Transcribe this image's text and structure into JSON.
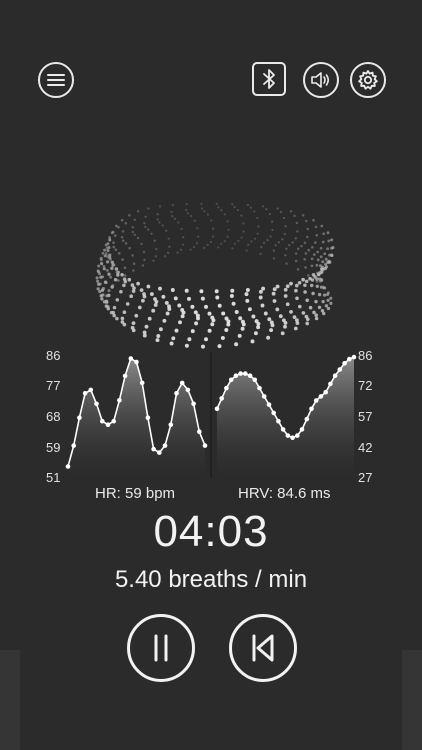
{
  "header": {
    "menu_icon": "hamburger-menu-icon",
    "bluetooth_icon": "bluetooth-icon",
    "sound_icon": "speaker-icon",
    "settings_icon": "gear-icon"
  },
  "hr_chart": {
    "y_ticks": [
      "86",
      "77",
      "68",
      "59",
      "51"
    ],
    "label": "HR: 59 bpm"
  },
  "hrv_chart": {
    "y_ticks": [
      "86",
      "72",
      "57",
      "42",
      "27"
    ],
    "label": "HRV: 84.6 ms"
  },
  "session": {
    "timer": "04:03",
    "rate": "5.40 breaths / min"
  },
  "controls": {
    "pause_icon": "pause-icon",
    "restart_icon": "skip-back-icon"
  },
  "chart_data": [
    {
      "type": "line",
      "ylim": [
        51,
        86
      ],
      "y_ticks": [
        86,
        77,
        68,
        59,
        51
      ],
      "x": [
        0,
        1,
        2,
        3,
        4,
        5,
        6,
        7,
        8,
        9,
        10,
        11,
        12,
        13,
        14,
        15,
        16,
        17,
        18,
        19,
        20,
        21,
        22,
        23,
        24
      ],
      "values": [
        54,
        60,
        68,
        75,
        76,
        72,
        67,
        66,
        67,
        73,
        80,
        85,
        84,
        78,
        68,
        59,
        58,
        60,
        66,
        75,
        78,
        76,
        72,
        64,
        60
      ]
    },
    {
      "type": "line",
      "ylim": [
        27,
        86
      ],
      "y_ticks": [
        86,
        72,
        57,
        42,
        27
      ],
      "x": [
        0,
        1,
        2,
        3,
        4,
        5,
        6,
        7,
        8,
        9,
        10,
        11,
        12,
        13,
        14,
        15,
        16,
        17,
        18,
        19,
        20,
        21,
        22,
        23,
        24,
        25,
        26,
        27,
        28,
        29
      ],
      "values": [
        60,
        65,
        70,
        74,
        76,
        77,
        77,
        76,
        74,
        70,
        66,
        62,
        58,
        54,
        50,
        47,
        46,
        47,
        50,
        55,
        60,
        64,
        66,
        68,
        72,
        76,
        79,
        82,
        84,
        85
      ]
    }
  ]
}
